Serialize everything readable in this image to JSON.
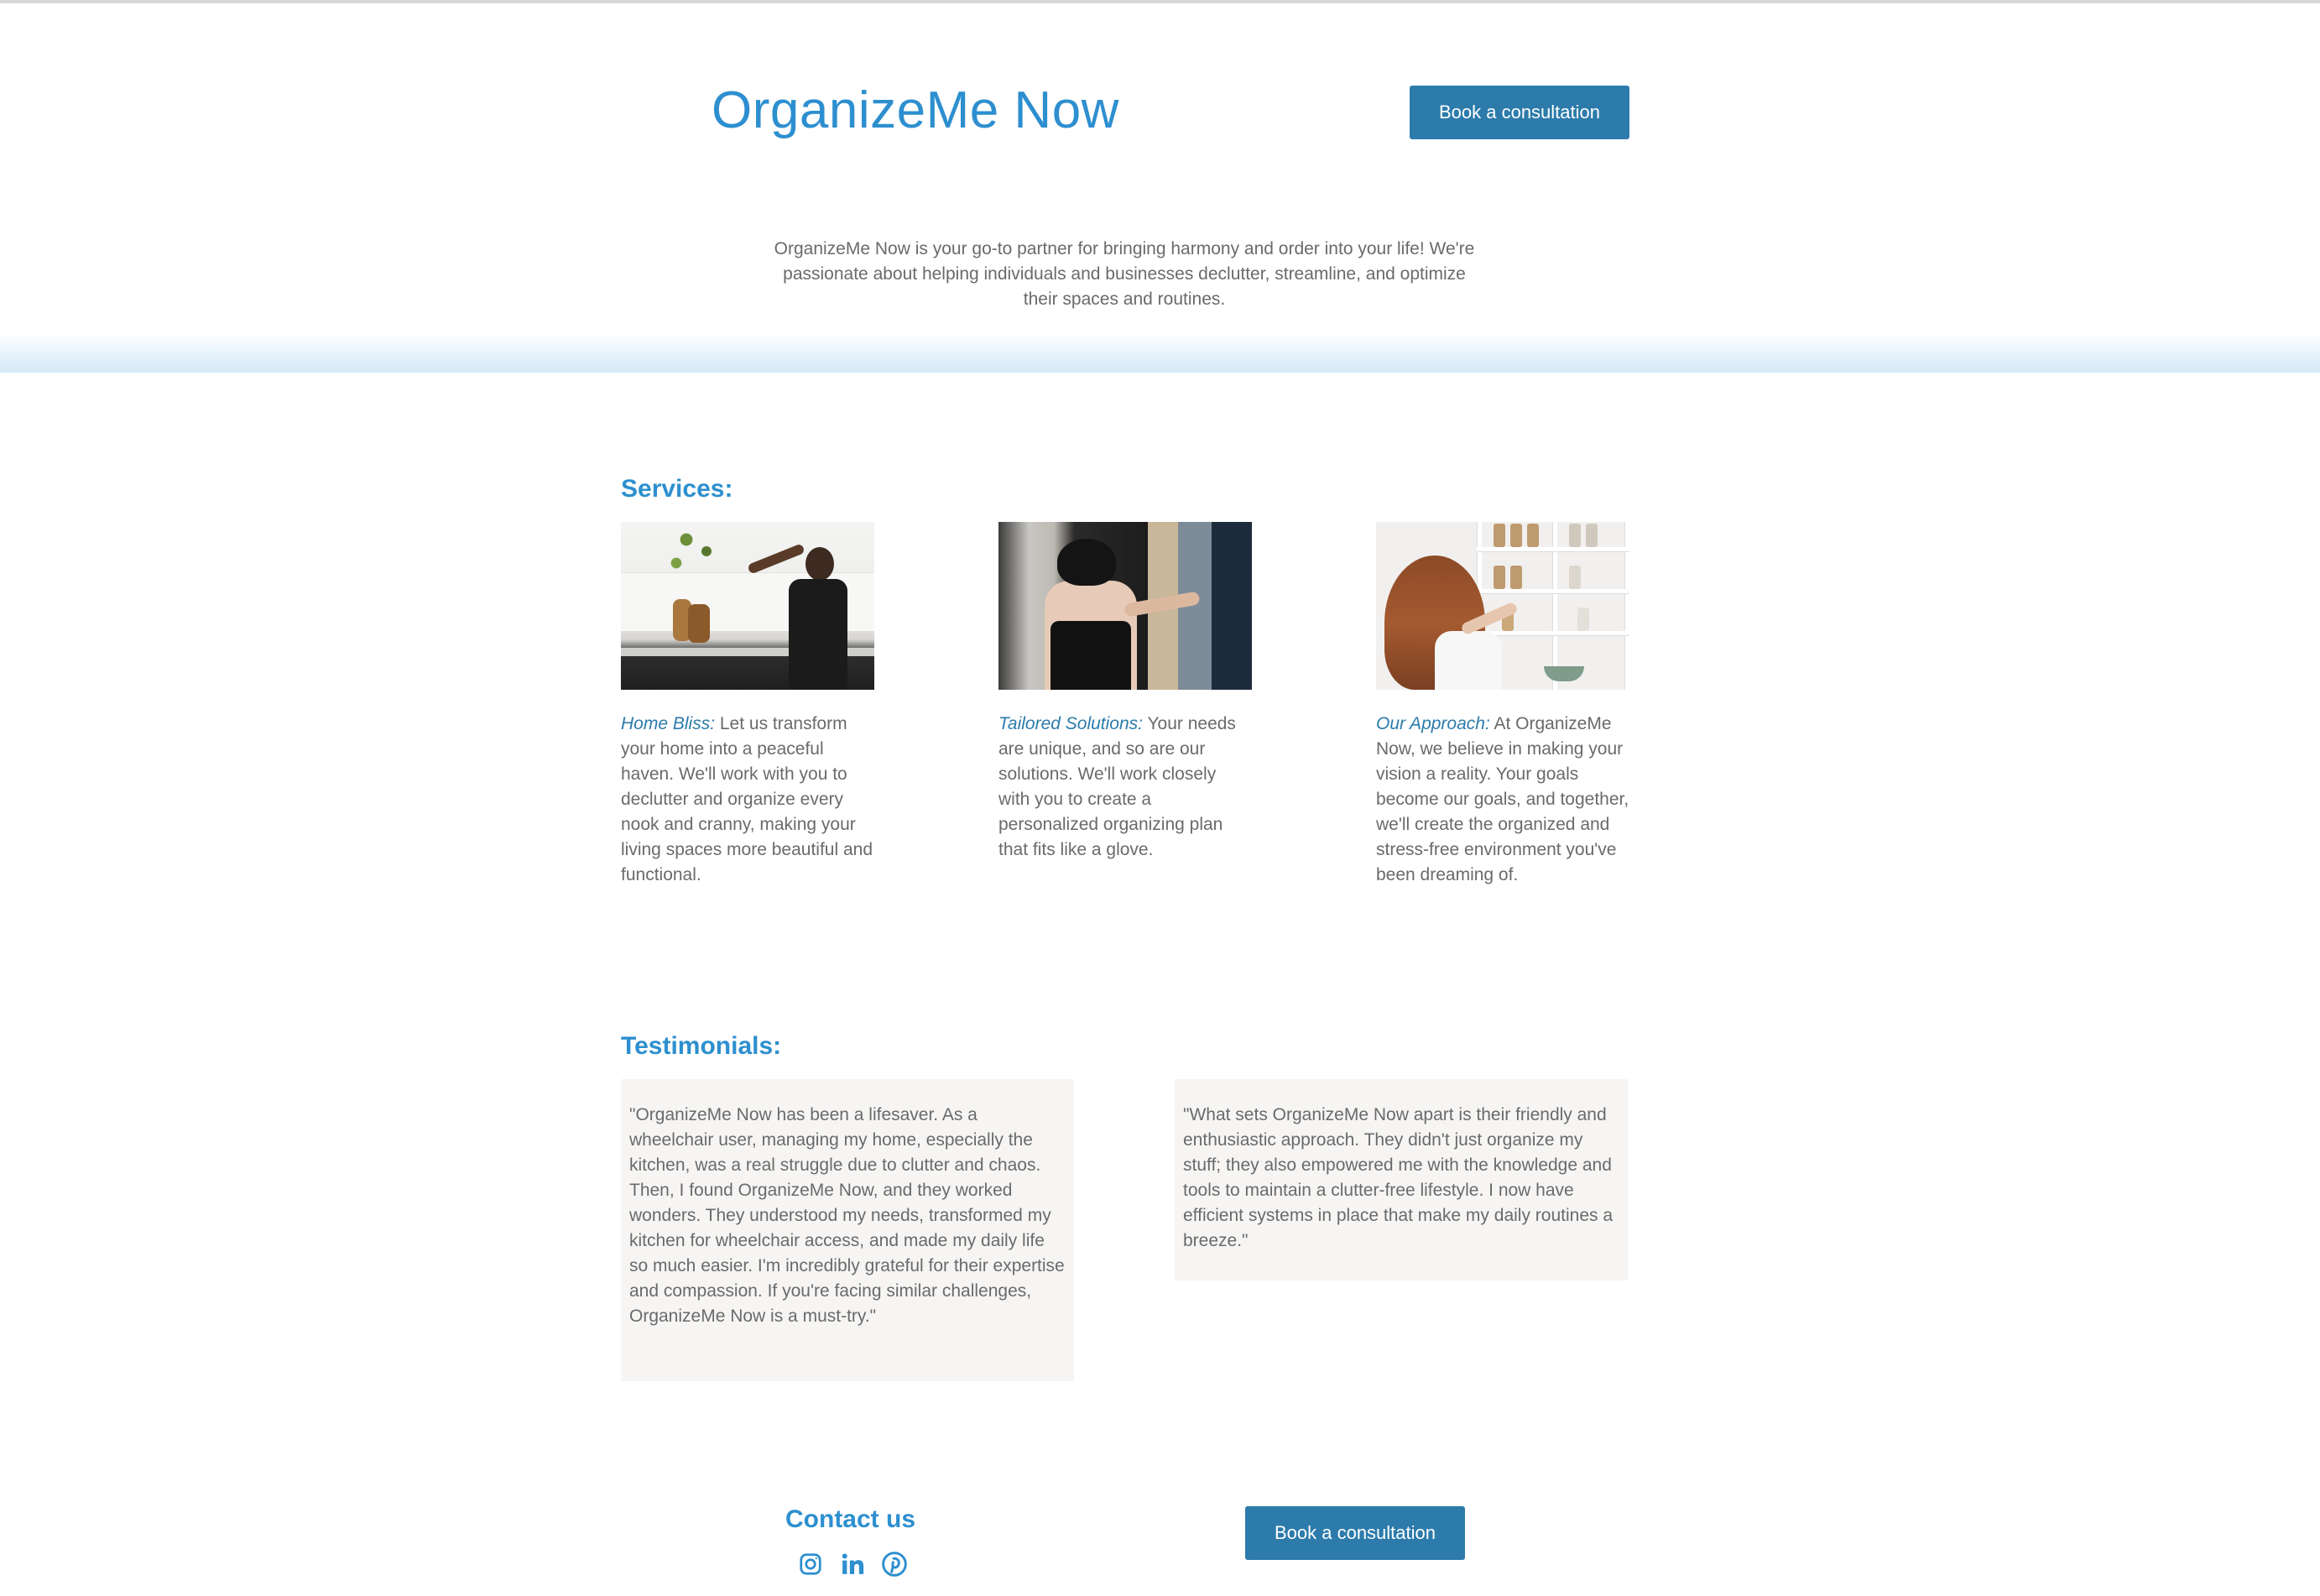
{
  "header": {
    "brand": "OrganizeMe Now",
    "cta_label": "Book a consultation"
  },
  "intro": {
    "text": "OrganizeMe Now is your go-to partner for bringing harmony and order into your life! We're passionate about helping individuals and businesses declutter, streamline, and optimize their spaces and routines."
  },
  "services": {
    "title": "Services:",
    "items": [
      {
        "lead": "Home Bliss:",
        "text": " Let us transform your home into a peaceful haven. We'll work with you to declutter and organize every nook and cranny, making your living spaces more beautiful and functional."
      },
      {
        "lead": "Tailored Solutions:",
        "text": " Your needs are unique, and so are our solutions. We'll work closely with you to create a personalized organizing plan that fits like a glove."
      },
      {
        "lead": "Our Approach:",
        "text": " At OrganizeMe Now, we believe in making your vision a reality. Your goals become our goals, and together, we'll create the organized and stress-free environment you've been dreaming of."
      }
    ]
  },
  "testimonials": {
    "title": "Testimonials:",
    "items": [
      {
        "text": "\"OrganizeMe Now has been a lifesaver. As a wheelchair user, managing my home, especially the kitchen, was a real struggle due to clutter and chaos. Then, I found OrganizeMe Now, and they worked wonders. They understood my needs, transformed my kitchen for wheelchair access, and made my daily life so much easier. I'm incredibly grateful for their expertise and compassion. If you're facing similar challenges, OrganizeMe Now is a must-try.\""
      },
      {
        "text": "\"What sets OrganizeMe Now apart is their friendly and enthusiastic approach. They didn't just organize my stuff; they also empowered me with the knowledge and tools to maintain a clutter-free lifestyle. I now have efficient systems in place that make my daily routines a breeze.\""
      }
    ]
  },
  "footer": {
    "contact_title": "Contact us",
    "cta_label": "Book a consultation",
    "socials": [
      "instagram-icon",
      "linkedin-icon",
      "pinterest-icon"
    ]
  },
  "colors": {
    "brand_blue": "#2d8fcf",
    "button_blue": "#2c7bab",
    "testimonial_bg": "#f6f5f4"
  }
}
